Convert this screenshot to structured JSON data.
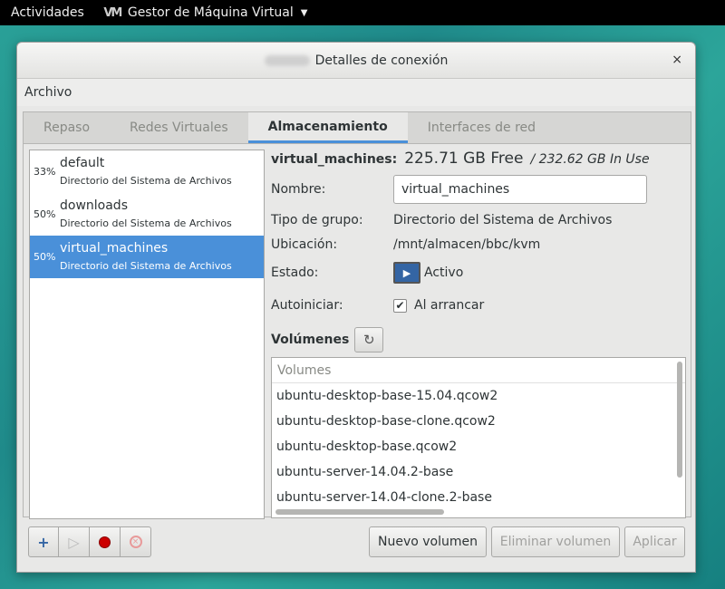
{
  "topbar": {
    "activities": "Actividades",
    "app_name": "Gestor de Máquina Virtual",
    "app_logo_text": "VM",
    "caret": "▼"
  },
  "window": {
    "title": "Detalles de conexión",
    "close": "×",
    "menu": {
      "file": "Archivo"
    }
  },
  "tabs": [
    {
      "label": "Repaso",
      "active": false
    },
    {
      "label": "Redes Virtuales",
      "active": false
    },
    {
      "label": "Almacenamiento",
      "active": true
    },
    {
      "label": "Interfaces de red",
      "active": false
    }
  ],
  "pools": [
    {
      "percent": "33%",
      "name": "default",
      "type": "Directorio del Sistema de Archivos",
      "selected": false
    },
    {
      "percent": "50%",
      "name": "downloads",
      "type": "Directorio del Sistema de Archivos",
      "selected": false
    },
    {
      "percent": "50%",
      "name": "virtual_machines",
      "type": "Directorio del Sistema de Archivos",
      "selected": true
    }
  ],
  "details": {
    "pool_name": "virtual_machines:",
    "free": "225.71 GB Free",
    "in_use": "/ 232.62 GB In Use",
    "name_label": "Nombre:",
    "name_value": "virtual_machines",
    "type_label": "Tipo de grupo:",
    "type_value": "Directorio del Sistema de Archivos",
    "location_label": "Ubicación:",
    "location_value": "/mnt/almacen/bbc/kvm",
    "state_label": "Estado:",
    "state_value": "Activo",
    "autostart_label": "Autoiniciar:",
    "autostart_value": "Al arrancar",
    "autostart_checked": true,
    "volumes_label": "Volúmenes"
  },
  "volumes": {
    "header": "Volumes",
    "items": [
      "ubuntu-desktop-base-15.04.qcow2",
      "ubuntu-desktop-base-clone.qcow2",
      "ubuntu-desktop-base.qcow2",
      "ubuntu-server-14.04.2-base",
      "ubuntu-server-14.04-clone.2-base"
    ]
  },
  "toolbar": {
    "add": "+",
    "play": "▷",
    "stop": "×"
  },
  "buttons": {
    "new_volume": "Nuevo volumen",
    "delete_volume": "Eliminar volumen",
    "apply": "Aplicar"
  }
}
